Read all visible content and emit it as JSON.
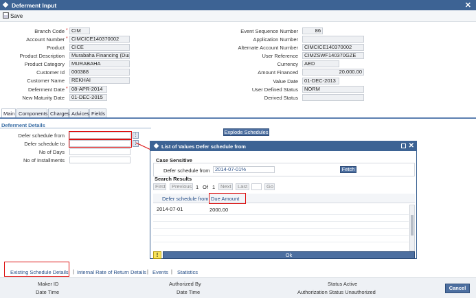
{
  "window": {
    "title": "Deferment Input",
    "close": "✕"
  },
  "toolbar": {
    "save_label": "Save"
  },
  "left_fields": [
    {
      "label": "Branch Code",
      "value": "CIM",
      "required": true
    },
    {
      "label": "Account Number",
      "value": "CIMCICE140370002",
      "required": true
    },
    {
      "label": "Product",
      "value": "CICE"
    },
    {
      "label": "Product Description",
      "value": "Murabaha Financing (Dual F"
    },
    {
      "label": "Product Category",
      "value": "MURABAHA"
    },
    {
      "label": "Customer Id",
      "value": "000388"
    },
    {
      "label": "Customer Name",
      "value": "REKHAI"
    },
    {
      "label": "Deferment Date",
      "value": "08-APR-2014",
      "required": true
    },
    {
      "label": "New Maturity Date",
      "value": "01-DEC-2015"
    }
  ],
  "right_fields": [
    {
      "label": "Event Sequence Number",
      "value": "86"
    },
    {
      "label": "Application Number",
      "value": ""
    },
    {
      "label": "Alternate Account Number",
      "value": "CIMCICE140370002"
    },
    {
      "label": "User Reference",
      "value": "CIMZSWF140370GZE"
    },
    {
      "label": "Currency",
      "value": "AED"
    },
    {
      "label": "Amount Financed",
      "value": "20,000.00"
    },
    {
      "label": "Value Date",
      "value": "01-DEC-2013"
    },
    {
      "label": "User Defined Status",
      "value": "NORM"
    },
    {
      "label": "Derived Status",
      "value": ""
    }
  ],
  "tabs": [
    "Main",
    "Components",
    "Charges",
    "Advices",
    "Fields"
  ],
  "section_title": "Deferment Details",
  "deferment_fields": [
    {
      "label": "Defer schedule from",
      "value": ""
    },
    {
      "label": "Defer schedule to",
      "value": ""
    },
    {
      "label": "No of Days",
      "value": ""
    },
    {
      "label": "No of Installments",
      "value": ""
    }
  ],
  "explode_button": "Explode Schedules",
  "lov_dialog": {
    "title": "List of Values Defer schedule from",
    "case_sensitive": "Case Sensitive",
    "search_label": "Defer schedule from",
    "search_value": "2014-07-01%",
    "fetch": "Fetch",
    "results_title": "Search Results",
    "pager": {
      "first": "First",
      "previous": "Previous",
      "page": "1",
      "of": "Of",
      "total": "1",
      "next": "Next",
      "last": "Last",
      "go": "Go"
    },
    "columns": [
      "Defer schedule from",
      "Due Amount"
    ],
    "rows": [
      {
        "from": "2014-07-01",
        "amount": "2000.00"
      }
    ],
    "ok": "Ok",
    "warning_icon": "!"
  },
  "bottom_tabs": [
    "Existing Schedule Details",
    "Internal Rate of Return Details",
    "Events",
    "Statistics"
  ],
  "footer": {
    "maker_id": "Maker ID",
    "date_time": "Date Time",
    "authorized_by": "Authorized By",
    "date_time2": "Date Time",
    "status_active": "Status Active",
    "auth_status": "Authorization Status Unauthorized",
    "cancel": "Cancel"
  },
  "colors": {
    "titlebar": "#3d6394",
    "accent": "#4d6fa0",
    "highlight": "#dd1111"
  }
}
